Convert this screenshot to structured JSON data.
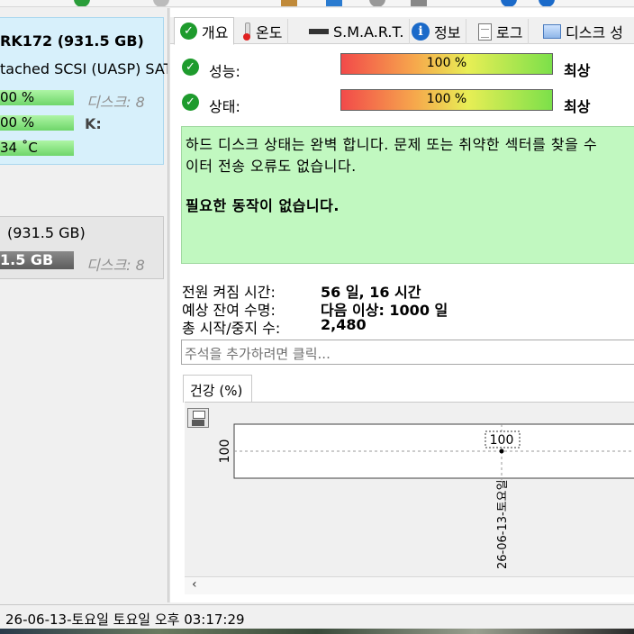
{
  "app": {
    "accent": "#1e9b2d"
  },
  "left": {
    "disk1": {
      "model": "RK172 (931.5 GB)",
      "interface": "tached SCSI (UASP) SAT",
      "bar1": "00 %",
      "disk_label": "디스크: 8",
      "bar2": "00 %",
      "k_label": "K:",
      "temp": "34 ˚C"
    },
    "disk2": {
      "size": "(931.5 GB)",
      "bar": "1.5 GB",
      "disk_label": "디스크: 8"
    }
  },
  "tabs": [
    {
      "label": "개요",
      "icon": "check-icon"
    },
    {
      "label": "온도",
      "icon": "thermometer-icon"
    },
    {
      "label": "S.M.A.R.T.",
      "icon": "smart-icon"
    },
    {
      "label": "정보",
      "icon": "info-icon"
    },
    {
      "label": "로그",
      "icon": "document-icon"
    },
    {
      "label": "디스크 성",
      "icon": "image-icon"
    }
  ],
  "overview": {
    "performance": {
      "label": "성능:",
      "value": "100 %",
      "rating": "최상"
    },
    "health": {
      "label": "상태:",
      "value": "100 %",
      "rating": "최상"
    },
    "message": {
      "line1": "하드 디스크 상태는 완벽 합니다. 문제 또는 취약한 섹터를 찾을 수",
      "line2": "이터 전송 오류도 없습니다.",
      "action": "필요한 동작이 없습니다."
    },
    "power_on_label": "전원 켜짐 시간:",
    "power_on_value": "56 일, 16 시간",
    "lifetime_label": "예상 잔여 수명:",
    "lifetime_value": "다음 이상: 1000 일",
    "startstop_label": "총 시작/중지 수:",
    "startstop_value": "2,480",
    "comment_placeholder": "주석을 추가하려면 클릭..."
  },
  "health_tab": "건강 (%)",
  "chart_data": {
    "type": "line",
    "x": [
      "26-06-13-토요일"
    ],
    "series": [
      {
        "values": [
          100
        ]
      }
    ],
    "yticks": [
      "100"
    ],
    "data_labels": [
      "100"
    ],
    "grid": true
  },
  "scroll_left": "‹",
  "status": "26-06-13-토요일 토요일 오후 03:17:29"
}
